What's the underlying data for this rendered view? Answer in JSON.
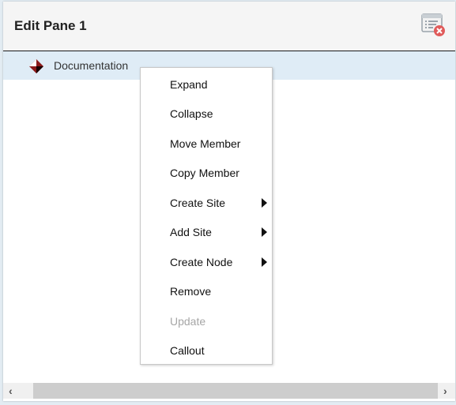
{
  "pane": {
    "title": "Edit Pane 1",
    "close_icon": "close-pane-icon"
  },
  "tree": {
    "nodes": [
      {
        "label": "Documentation",
        "icon": "diamond-node-icon",
        "selected": true
      }
    ]
  },
  "context_menu": {
    "items": [
      {
        "label": "Expand",
        "submenu": false,
        "disabled": false
      },
      {
        "label": "Collapse",
        "submenu": false,
        "disabled": false
      },
      {
        "label": "Move Member",
        "submenu": false,
        "disabled": false
      },
      {
        "label": "Copy Member",
        "submenu": false,
        "disabled": false
      },
      {
        "label": "Create Site",
        "submenu": true,
        "disabled": false
      },
      {
        "label": "Add Site",
        "submenu": true,
        "disabled": false
      },
      {
        "label": "Create Node",
        "submenu": true,
        "disabled": false
      },
      {
        "label": "Remove",
        "submenu": false,
        "disabled": false
      },
      {
        "label": "Update",
        "submenu": false,
        "disabled": true
      },
      {
        "label": "Callout",
        "submenu": false,
        "disabled": false
      }
    ]
  },
  "scrollbar": {
    "left_glyph": "‹",
    "right_glyph": "›"
  },
  "colors": {
    "selected_row": "#dfecf6",
    "disabled_text": "#a6a6a6",
    "node_icon": "#8b1a1a",
    "close_badge": "#e05b5b"
  }
}
